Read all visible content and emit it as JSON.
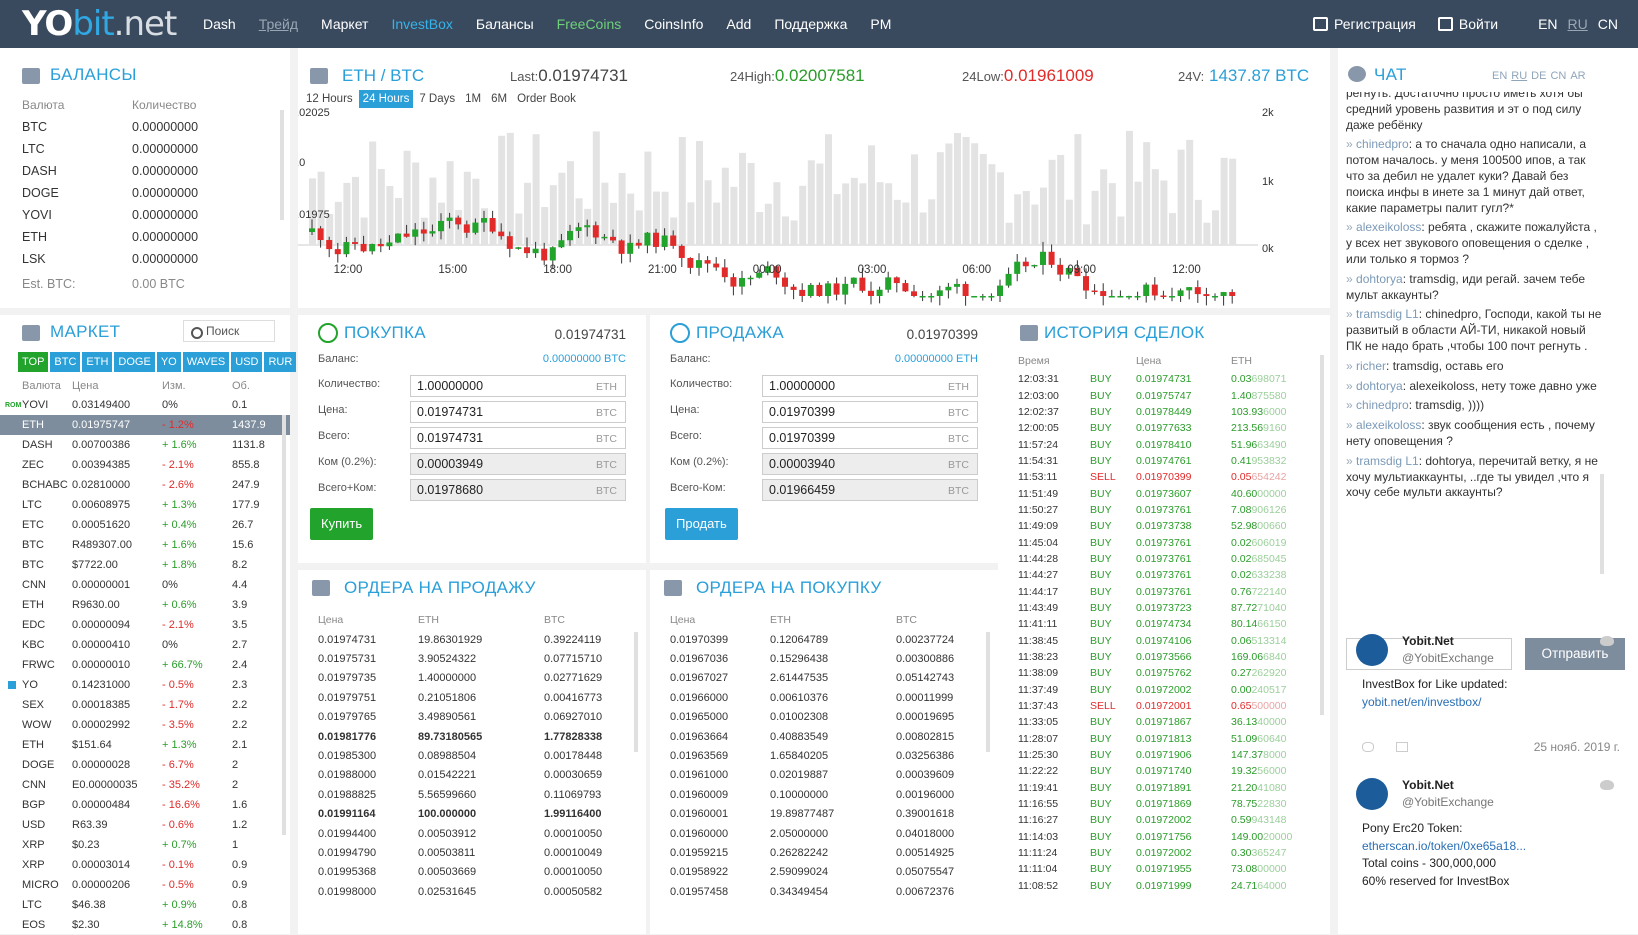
{
  "header": {
    "logo_a": "YO",
    "logo_b": "bit",
    "logo_c": ".net",
    "nav": [
      {
        "label": "Dash",
        "style": ""
      },
      {
        "label": "Трейд",
        "style": "dis"
      },
      {
        "label": "Маркет",
        "style": ""
      },
      {
        "label": "InvestBox",
        "style": "blue"
      },
      {
        "label": "Балансы",
        "style": ""
      },
      {
        "label": "FreeCoins",
        "style": "green"
      },
      {
        "label": "CoinsInfo",
        "style": ""
      },
      {
        "label": "Add",
        "style": ""
      },
      {
        "label": "Поддержка",
        "style": ""
      },
      {
        "label": "PM",
        "style": ""
      }
    ],
    "register": "Регистрация",
    "login": "Войти",
    "langs": [
      "EN",
      "RU",
      "CN"
    ]
  },
  "balances": {
    "title": "БАЛАНСЫ",
    "col_currency": "Валюта",
    "col_amount": "Количество",
    "rows": [
      [
        "BTC",
        "0.00000000"
      ],
      [
        "LTC",
        "0.00000000"
      ],
      [
        "DASH",
        "0.00000000"
      ],
      [
        "DOGE",
        "0.00000000"
      ],
      [
        "YOVI",
        "0.00000000"
      ],
      [
        "ETH",
        "0.00000000"
      ],
      [
        "LSK",
        "0.00000000"
      ]
    ],
    "est_label": "Est. BTC:",
    "est_value": "0.00 BTC"
  },
  "market": {
    "title": "МАРКЕТ",
    "search_placeholder": "Поиск",
    "tabs": [
      "TOP",
      "BTC",
      "ETH",
      "DOGE",
      "YO",
      "WAVES",
      "USD",
      "RUR"
    ],
    "headers": [
      "Валюта",
      "Цена",
      "Изм.",
      "Об."
    ],
    "rows": [
      [
        "YOVI",
        "0.03149400",
        "0%",
        "0.1",
        "",
        "rom"
      ],
      [
        "ETH",
        "0.01975747",
        "- 1.2%",
        "1437.9",
        "r",
        "sel"
      ],
      [
        "DASH",
        "0.00700386",
        "+ 1.6%",
        "1131.8",
        "g",
        ""
      ],
      [
        "ZEC",
        "0.00394385",
        "- 2.1%",
        "855.8",
        "r",
        ""
      ],
      [
        "BCHABC",
        "0.02810000",
        "- 2.6%",
        "247.9",
        "r",
        ""
      ],
      [
        "LTC",
        "0.00608975",
        "+ 1.3%",
        "177.9",
        "g",
        ""
      ],
      [
        "ETC",
        "0.00051620",
        "+ 0.4%",
        "26.7",
        "g",
        ""
      ],
      [
        "BTC",
        "R489307.00",
        "+ 1.6%",
        "15.6",
        "g",
        ""
      ],
      [
        "BTC",
        "$7722.00",
        "+ 1.8%",
        "8.2",
        "g",
        ""
      ],
      [
        "CNN",
        "0.00000001",
        "0%",
        "4.4",
        "",
        ""
      ],
      [
        "ETH",
        "R9630.00",
        "+ 0.6%",
        "3.9",
        "g",
        ""
      ],
      [
        "EDC",
        "0.00000094",
        "- 2.1%",
        "3.5",
        "r",
        ""
      ],
      [
        "KBC",
        "0.00000410",
        "0%",
        "2.7",
        "",
        ""
      ],
      [
        "FRWC",
        "0.00000010",
        "+ 66.7%",
        "2.4",
        "g",
        ""
      ],
      [
        "YO",
        "0.14231000",
        "- 0.5%",
        "2.3",
        "r",
        "sq"
      ],
      [
        "SEX",
        "0.00018385",
        "- 1.7%",
        "2.2",
        "r",
        ""
      ],
      [
        "WOW",
        "0.00002992",
        "- 3.5%",
        "2.2",
        "r",
        ""
      ],
      [
        "ETH",
        "$151.64",
        "+ 1.3%",
        "2.1",
        "g",
        ""
      ],
      [
        "DOGE",
        "0.00000028",
        "- 6.7%",
        "2",
        "r",
        ""
      ],
      [
        "CNN",
        "E0.00000035",
        "- 35.2%",
        "2",
        "r",
        ""
      ],
      [
        "BGP",
        "0.00000484",
        "- 16.6%",
        "1.6",
        "r",
        ""
      ],
      [
        "USD",
        "R63.39",
        "- 0.6%",
        "1.2",
        "r",
        ""
      ],
      [
        "XRP",
        "$0.23",
        "+ 0.7%",
        "1",
        "g",
        ""
      ],
      [
        "XRP",
        "0.00003014",
        "- 0.1%",
        "0.9",
        "r",
        ""
      ],
      [
        "MICRO",
        "0.00000206",
        "- 0.5%",
        "0.9",
        "r",
        ""
      ],
      [
        "LTC",
        "$46.38",
        "+ 0.9%",
        "0.8",
        "g",
        ""
      ],
      [
        "EOS",
        "$2.30",
        "+ 14.8%",
        "0.8",
        "g",
        ""
      ]
    ]
  },
  "chart": {
    "pair_a": "ETH",
    "pair_sep": " / ",
    "pair_b": "BTC",
    "last_label": "Last:",
    "last": "0.01974731",
    "high_label": "24High:",
    "high": "0.02007581",
    "low_label": "24Low:",
    "low": "0.01961009",
    "vol_label": "24V:",
    "vol": "1437.87 BTC",
    "periods": [
      "12 Hours",
      "24 Hours",
      "7 Days",
      "1M",
      "6M",
      "Order Book"
    ],
    "y_top": "0.02025",
    "y_mid": "0.0",
    "y_low": "0.01975",
    "vol_ticks": [
      "2k",
      "1k",
      "0k"
    ],
    "x_ticks": [
      "12:00",
      "15:00",
      "18:00",
      "21:00",
      "00:00",
      "03:00",
      "06:00",
      "09:00",
      "12:00"
    ]
  },
  "buy": {
    "title": "ПОКУПКА",
    "price": "0.01974731",
    "balance_label": "Баланс:",
    "balance": "0.00000000 BTC",
    "fields": [
      [
        "Количество:",
        "1.00000000",
        "ETH"
      ],
      [
        "Цена:",
        "0.01974731",
        "BTC"
      ],
      [
        "Всего:",
        "0.01974731",
        "BTC"
      ],
      [
        "Ком (0.2%):",
        "0.00003949",
        "BTC"
      ],
      [
        "Всего+Ком:",
        "0.01978680",
        "BTC"
      ]
    ],
    "button": "Купить"
  },
  "sell": {
    "title": "ПРОДАЖА",
    "price": "0.01970399",
    "balance_label": "Баланс:",
    "balance": "0.00000000 ETH",
    "fields": [
      [
        "Количество:",
        "1.00000000",
        "ETH"
      ],
      [
        "Цена:",
        "0.01970399",
        "BTC"
      ],
      [
        "Всего:",
        "0.01970399",
        "BTC"
      ],
      [
        "Ком (0.2%):",
        "0.00003940",
        "BTC"
      ],
      [
        "Всего-Ком:",
        "0.01966459",
        "BTC"
      ]
    ],
    "button": "Продать"
  },
  "sell_orders": {
    "title": "ОРДЕРА НА ПРОДАЖУ",
    "headers": [
      "Цена",
      "ETH",
      "BTC"
    ],
    "rows": [
      [
        "0.01974731",
        "19.86301929",
        "0.39224119",
        ""
      ],
      [
        "0.01975731",
        "3.90524322",
        "0.07715710",
        ""
      ],
      [
        "0.01979735",
        "1.40000000",
        "0.02771629",
        ""
      ],
      [
        "0.01979751",
        "0.21051806",
        "0.00416773",
        ""
      ],
      [
        "0.01979765",
        "3.49890561",
        "0.06927010",
        ""
      ],
      [
        "0.01981776",
        "89.73180565",
        "1.77828338",
        "b"
      ],
      [
        "0.01985300",
        "0.08988504",
        "0.00178448",
        ""
      ],
      [
        "0.01988000",
        "0.01542221",
        "0.00030659",
        ""
      ],
      [
        "0.01988825",
        "5.56599660",
        "0.11069793",
        ""
      ],
      [
        "0.01991164",
        "100.000000",
        "1.99116400",
        "b"
      ],
      [
        "0.01994400",
        "0.00503912",
        "0.00010050",
        ""
      ],
      [
        "0.01994790",
        "0.00503811",
        "0.00010049",
        ""
      ],
      [
        "0.01995368",
        "0.00503669",
        "0.00010050",
        ""
      ],
      [
        "0.01998000",
        "0.02531645",
        "0.00050582",
        ""
      ]
    ]
  },
  "buy_orders": {
    "title": "ОРДЕРА НА ПОКУПКУ",
    "headers": [
      "Цена",
      "ETH",
      "BTC"
    ],
    "rows": [
      [
        "0.01970399",
        "0.12064789",
        "0.00237724",
        ""
      ],
      [
        "0.01967036",
        "0.15296438",
        "0.00300886",
        ""
      ],
      [
        "0.01967027",
        "2.61447535",
        "0.05142743",
        ""
      ],
      [
        "0.01966000",
        "0.00610376",
        "0.00011999",
        ""
      ],
      [
        "0.01965000",
        "0.01002308",
        "0.00019695",
        ""
      ],
      [
        "0.01963664",
        "0.40883549",
        "0.00802815",
        ""
      ],
      [
        "0.01963569",
        "1.65840205",
        "0.03256386",
        ""
      ],
      [
        "0.01961000",
        "0.02019887",
        "0.00039609",
        ""
      ],
      [
        "0.01960009",
        "0.10000000",
        "0.00196000",
        ""
      ],
      [
        "0.01960001",
        "19.89877487",
        "0.39001618",
        ""
      ],
      [
        "0.01960000",
        "2.05000000",
        "0.04018000",
        ""
      ],
      [
        "0.01959215",
        "0.26282242",
        "0.00514925",
        ""
      ],
      [
        "0.01958922",
        "2.59099024",
        "0.05075547",
        ""
      ],
      [
        "0.01957458",
        "0.34349454",
        "0.00672376",
        ""
      ]
    ]
  },
  "history": {
    "title": "ИСТОРИЯ СДЕЛОК",
    "headers": [
      "Время",
      "",
      "Цена",
      "ETH"
    ],
    "rows": [
      [
        "12:03:31",
        "BUY",
        "0.01974731",
        "0.03",
        "698071"
      ],
      [
        "12:03:00",
        "BUY",
        "0.01975747",
        "1.40",
        "875580"
      ],
      [
        "12:02:37",
        "BUY",
        "0.01978449",
        "103.93",
        "6000"
      ],
      [
        "12:00:05",
        "BUY",
        "0.01977633",
        "213.56",
        "9160"
      ],
      [
        "11:57:24",
        "BUY",
        "0.01978410",
        "51.96",
        "63490"
      ],
      [
        "11:54:31",
        "BUY",
        "0.01974761",
        "0.41",
        "953832"
      ],
      [
        "11:53:11",
        "SELL",
        "0.01970399",
        "0.05",
        "654242"
      ],
      [
        "11:51:49",
        "BUY",
        "0.01973607",
        "40.60",
        "00000"
      ],
      [
        "11:50:27",
        "BUY",
        "0.01973761",
        "7.08",
        "906126"
      ],
      [
        "11:49:09",
        "BUY",
        "0.01973738",
        "52.98",
        "00660"
      ],
      [
        "11:45:04",
        "BUY",
        "0.01973761",
        "0.02",
        "606019"
      ],
      [
        "11:44:28",
        "BUY",
        "0.01973761",
        "0.02",
        "685045"
      ],
      [
        "11:44:27",
        "BUY",
        "0.01973761",
        "0.02",
        "633238"
      ],
      [
        "11:44:17",
        "BUY",
        "0.01973761",
        "0.76",
        "722140"
      ],
      [
        "11:43:49",
        "BUY",
        "0.01973723",
        "87.72",
        "71040"
      ],
      [
        "11:41:11",
        "BUY",
        "0.01974734",
        "80.14",
        "66150"
      ],
      [
        "11:38:45",
        "BUY",
        "0.01974106",
        "0.06",
        "513314"
      ],
      [
        "11:38:23",
        "BUY",
        "0.01973566",
        "169.06",
        "6840"
      ],
      [
        "11:38:09",
        "BUY",
        "0.01975762",
        "0.27",
        "262920"
      ],
      [
        "11:37:49",
        "BUY",
        "0.01972002",
        "0.00",
        "240517"
      ],
      [
        "11:37:43",
        "SELL",
        "0.01972001",
        "0.65",
        "500000"
      ],
      [
        "11:33:05",
        "BUY",
        "0.01971867",
        "36.13",
        "40000"
      ],
      [
        "11:28:07",
        "BUY",
        "0.01971813",
        "51.09",
        "60640"
      ],
      [
        "11:25:30",
        "BUY",
        "0.01971906",
        "147.37",
        "8000"
      ],
      [
        "11:22:22",
        "BUY",
        "0.01971740",
        "19.32",
        "56000"
      ],
      [
        "11:19:41",
        "BUY",
        "0.01971891",
        "21.20",
        "41080"
      ],
      [
        "11:16:55",
        "BUY",
        "0.01971869",
        "78.75",
        "22830"
      ],
      [
        "11:16:27",
        "BUY",
        "0.01972002",
        "0.59",
        "943148"
      ],
      [
        "11:14:03",
        "BUY",
        "0.01971756",
        "149.00",
        "20000"
      ],
      [
        "11:11:24",
        "BUY",
        "0.01972002",
        "0.30",
        "365247"
      ],
      [
        "11:11:04",
        "BUY",
        "0.01971955",
        "73.08",
        "00000"
      ],
      [
        "11:08:52",
        "BUY",
        "0.01971999",
        "24.71",
        "64000"
      ]
    ]
  },
  "chat": {
    "title": "ЧАТ",
    "langs": [
      "EN",
      "RU",
      "DE",
      "CN",
      "AR"
    ],
    "messages": [
      {
        "name": "",
        "text": "регнуть. Достаточно просто иметь хотя бы средний уровень развития и эт о под силу даже ребёнку"
      },
      {
        "name": "chinedpro",
        "text": ": а то сначала одно написали, а потом началось. у меня 100500 ипов, а так что за дебил не удалет куки? Давай без поиска инфы в инете за 1 минут дай ответ, какие параметры палит гугл?*"
      },
      {
        "name": "alexeikoloss",
        "text": ": ребята , скажите пожалуйста , у всех нет звукового оповещения о сделке , или только я тормоз ?"
      },
      {
        "name": "dohtorya",
        "text": ": tramsdig, иди регай. зачем тебе мульт аккаунты?"
      },
      {
        "name": "tramsdig L1",
        "text": ": chinedpro, Господи, какой ты не развитый в области АЙ-ТИ, никакой новый ПК не надо брать ,чтобы 100 почт регнуть ."
      },
      {
        "name": "richer",
        "text": ": tramsdig, оставь его"
      },
      {
        "name": "dohtorya",
        "text": ": alexeikoloss, нету тоже давно уже"
      },
      {
        "name": "chinedpro",
        "text": ": tramsdig, ))))"
      },
      {
        "name": "alexeikoloss",
        "text": ": звук сообщения есть , почему нету оповещения ?"
      },
      {
        "name": "tramsdig L1",
        "text": ": dohtorya, перечитай ветку, я не хочу мультиаккаунты, ..где ты увидел ,что я хочу себе мульти аккаунты?"
      }
    ],
    "send": "Отправить",
    "tweets": [
      {
        "name": "Yobit.Net",
        "handle": "@YobitExchange",
        "lines": [
          "InvestBox for Like updated:"
        ],
        "link": "yobit.net/en/investbox/",
        "after": [],
        "date": "25 нояб. 2019 г."
      },
      {
        "name": "Yobit.Net",
        "handle": "@YobitExchange",
        "lines": [
          "Pony Erc20 Token:"
        ],
        "link": "etherscan.io/token/0xe65a18...",
        "after": [
          "Total coins - 300,000,000",
          "60% reserved for InvestBox"
        ],
        "date": ""
      }
    ]
  }
}
